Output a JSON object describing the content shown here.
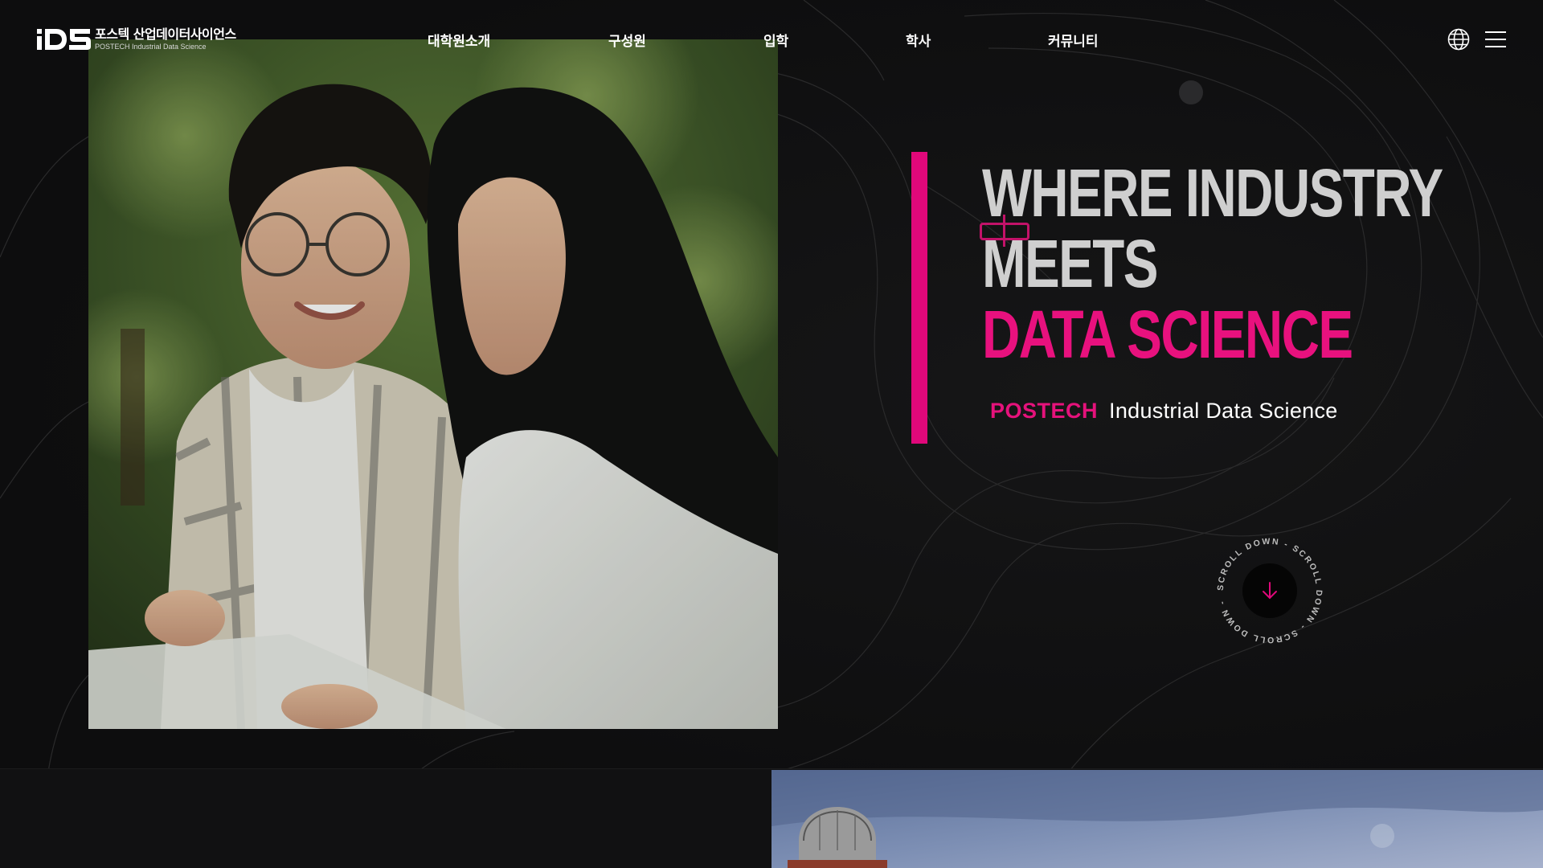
{
  "header": {
    "logo_mark": "iDS",
    "logo_korean": "포스텍 산업데이터사이언스",
    "logo_english": "POSTECH Industrial Data Science",
    "nav": [
      {
        "label": "대학원소개"
      },
      {
        "label": "구성원"
      },
      {
        "label": "입학"
      },
      {
        "label": "학사"
      },
      {
        "label": "커뮤니티"
      }
    ],
    "language_icon": "globe-icon",
    "menu_icon": "hamburger-menu-icon"
  },
  "hero": {
    "headline_line1": "WHERE INDUSTRY",
    "headline_line2": "MEETS",
    "headline_line3": "DATA SCIENCE",
    "subtitle_brand": "POSTECH",
    "subtitle_name": "Industrial Data Science",
    "scroll_label": "SCROLL DOWN - SCROLL DOWN - SCROLL DOWN - ",
    "scroll_icon": "arrow-down-icon"
  },
  "colors": {
    "accent": "#e0087a",
    "background": "#0e0e0f",
    "headline_gray": "#cfcfcf",
    "text": "#ffffff"
  }
}
